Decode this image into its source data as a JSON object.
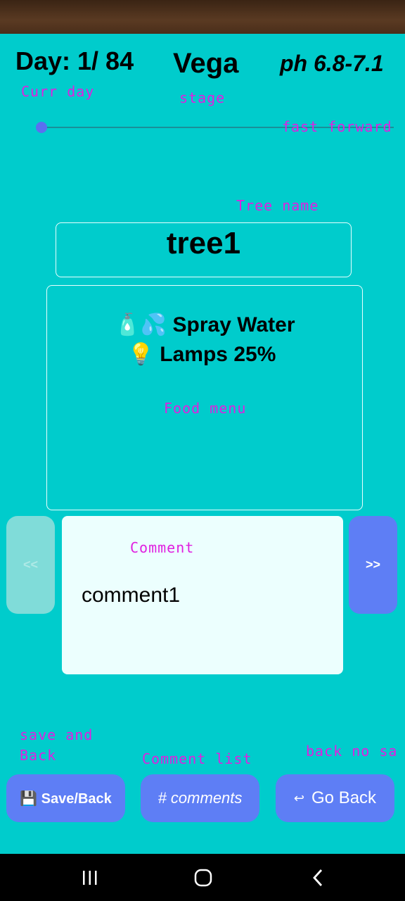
{
  "header": {
    "day": "Day: 1/ 84",
    "stage": "Vega",
    "ph": "ph 6.8-7.1"
  },
  "hints": {
    "curr_day": "Curr day",
    "stage": "stage",
    "fast_forward": "fast forward",
    "tree_name": "Tree name",
    "food_menu": "Food menu",
    "comment": "Comment",
    "save_back_1": "save and",
    "save_back_2": "Back",
    "comment_list": "Comment list",
    "back_no_save": "back no sa"
  },
  "slider": {
    "position": 0
  },
  "tree": {
    "name": "tree1"
  },
  "food": {
    "line1": "🧴💦 Spray Water",
    "line2": "💡 Lamps 25%"
  },
  "nav": {
    "prev": "<<",
    "next": ">>"
  },
  "comment": {
    "text": "comment1"
  },
  "buttons": {
    "save": "💾 Save/Back",
    "comments": "# comments",
    "go_back_icon": "↩",
    "go_back": "Go Back"
  },
  "icons": {
    "status": "status-bar",
    "recents": "recents-icon",
    "home": "home-icon",
    "back": "back-icon"
  },
  "colors": {
    "background": "#00cccc",
    "button": "#5e7ef5",
    "hint": "#e020e0"
  }
}
